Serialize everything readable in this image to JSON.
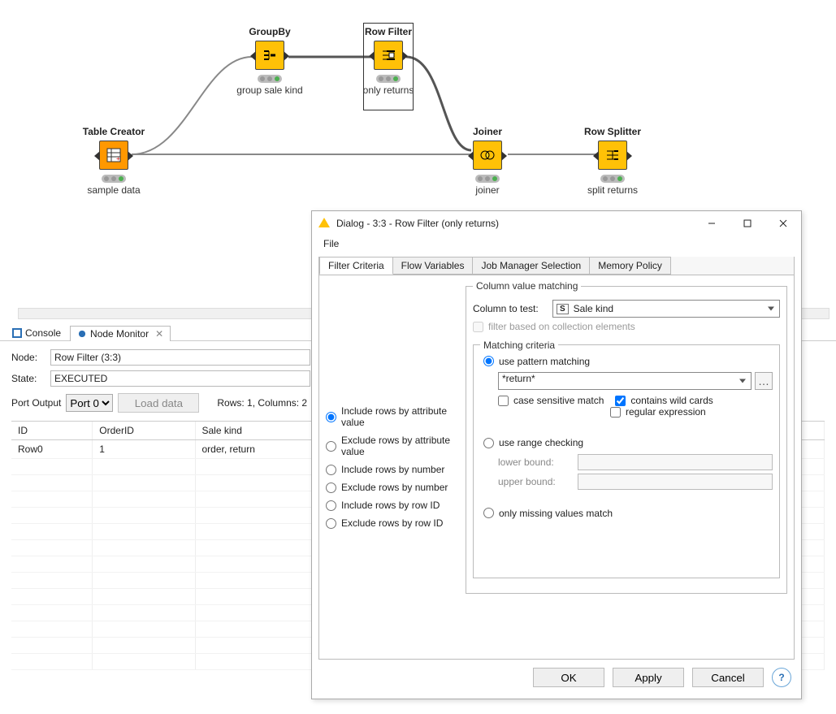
{
  "workflow": {
    "nodes": {
      "tableCreator": {
        "title": "Table Creator",
        "subtitle": "sample data"
      },
      "groupBy": {
        "title": "GroupBy",
        "subtitle": "group sale kind"
      },
      "rowFilter": {
        "title": "Row Filter",
        "subtitle": "only returns"
      },
      "joiner": {
        "title": "Joiner",
        "subtitle": "joiner"
      },
      "rowSplitter": {
        "title": "Row Splitter",
        "subtitle": "split returns"
      }
    }
  },
  "bottomTabs": {
    "console": "Console",
    "nodeMonitor": "Node Monitor"
  },
  "monitor": {
    "nodeLabel": "Node:",
    "nodeValue": "Row Filter  (3:3)",
    "stateLabel": "State:",
    "stateValue": "EXECUTED",
    "portLabel": "Port Output",
    "portValue": "Port 0",
    "loadBtn": "Load data",
    "summary": "Rows: 1, Columns: 2",
    "table": {
      "headers": [
        "ID",
        "OrderID",
        "Sale kind"
      ],
      "rows": [
        [
          "Row0",
          "1",
          "order, return"
        ]
      ]
    }
  },
  "dialog": {
    "title": "Dialog - 3:3 - Row Filter (only returns)",
    "menu": {
      "file": "File"
    },
    "tabs": {
      "filterCriteria": "Filter Criteria",
      "flowVariables": "Flow Variables",
      "jobManager": "Job Manager Selection",
      "memoryPolicy": "Memory Policy"
    },
    "leftOptions": {
      "includeAttr": "Include rows by attribute value",
      "excludeAttr": "Exclude rows by attribute value",
      "includeNum": "Include rows by number",
      "excludeNum": "Exclude rows by number",
      "includeId": "Include rows by row ID",
      "excludeId": "Exclude rows by row ID"
    },
    "colMatch": {
      "legend": "Column value matching",
      "columnToTest": "Column to test:",
      "columnTypeTag": "S",
      "columnValue": "Sale kind",
      "filterCollection": "filter based on collection elements"
    },
    "criteria": {
      "legend": "Matching criteria",
      "usePattern": "use pattern matching",
      "patternValue": "*return*",
      "caseSensitive": "case sensitive match",
      "wildCards": "contains wild cards",
      "regex": "regular expression",
      "useRange": "use range checking",
      "lower": "lower bound:",
      "upper": "upper bound:",
      "onlyMissing": "only missing values match"
    },
    "buttons": {
      "ok": "OK",
      "apply": "Apply",
      "cancel": "Cancel"
    }
  }
}
